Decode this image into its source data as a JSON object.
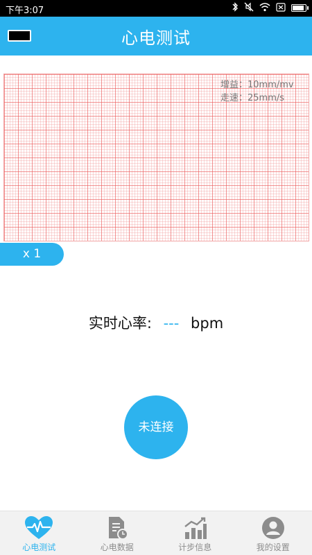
{
  "status_bar": {
    "time": "下午3:07"
  },
  "app_bar": {
    "title": "心电测试"
  },
  "ecg_panel": {
    "gain": "增益：10mm/mv",
    "speed": "走速：25mm/s"
  },
  "zoom": {
    "label": "x 1"
  },
  "heart_rate": {
    "label": "实时心率:",
    "value": "---",
    "unit": "bpm"
  },
  "connect_button": {
    "label": "未连接"
  },
  "tabs": [
    {
      "label": "心电测试",
      "icon": "heart-ecg-icon",
      "active": true
    },
    {
      "label": "心电数据",
      "icon": "document-clock-icon",
      "active": false
    },
    {
      "label": "计步信息",
      "icon": "bar-chart-icon",
      "active": false
    },
    {
      "label": "我的设置",
      "icon": "user-icon",
      "active": false
    }
  ],
  "colors": {
    "accent": "#2db3ee",
    "grid": "#f09a9a",
    "tab_inactive": "#8c8c8c"
  }
}
